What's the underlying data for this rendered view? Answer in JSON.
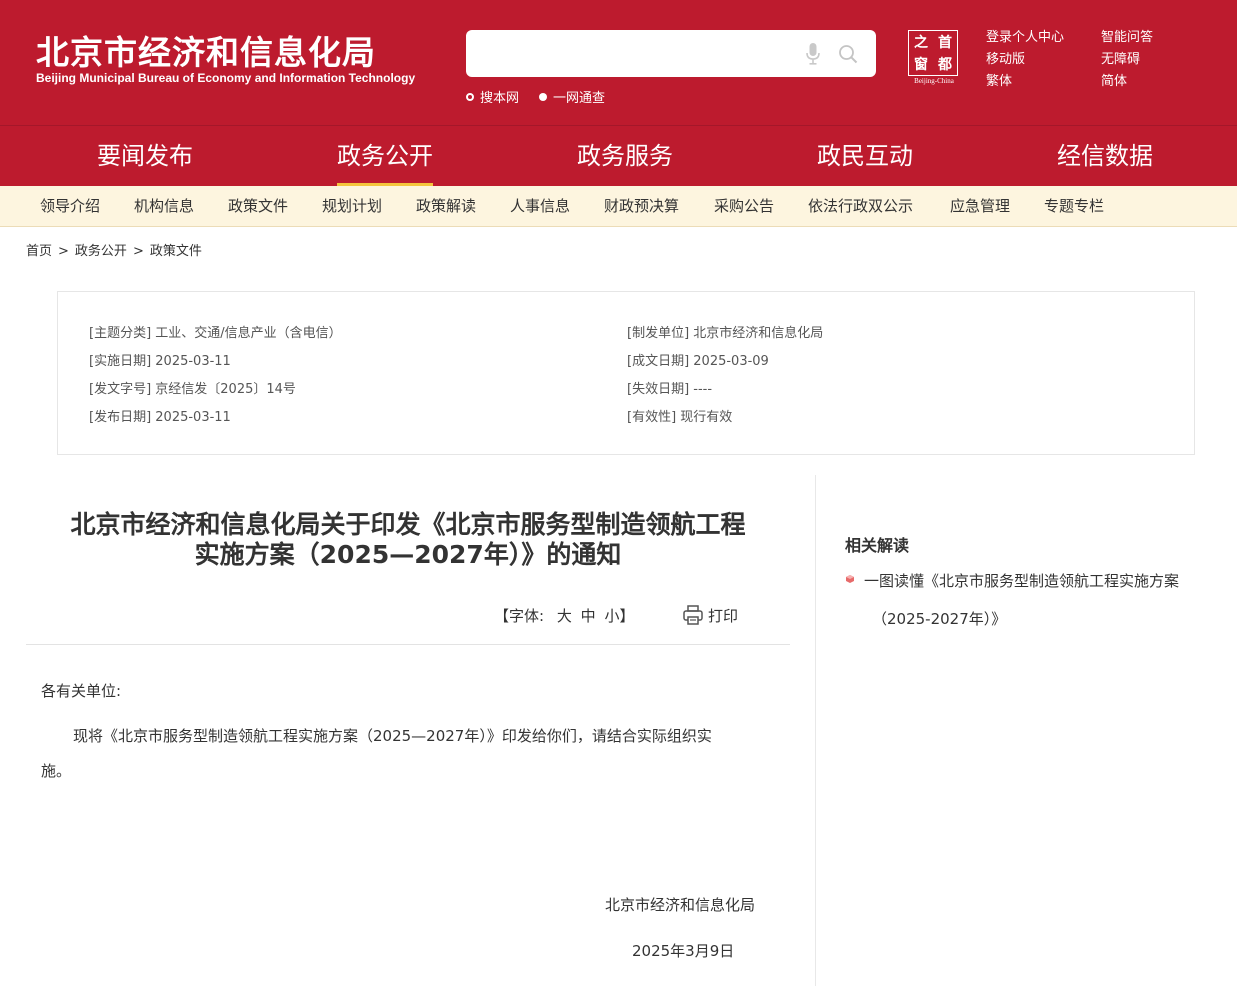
{
  "header": {
    "logo_cn": "北京市经济和信息化局",
    "logo_en": "Beijing Municipal Bureau of Economy and Information Technology",
    "search": {
      "placeholder": "",
      "scope_site": "搜本网",
      "scope_all": "一网通查"
    },
    "seal": {
      "chars": [
        "之",
        "首",
        "窗",
        "都"
      ],
      "en": "Beijing-China"
    },
    "links": {
      "login": "登录个人中心",
      "qa": "智能问答",
      "mobile": "移动版",
      "accessible": "无障碍",
      "traditional": "繁体",
      "simplified": "简体"
    },
    "colors": {
      "brand": "#bd1b2e",
      "accent": "#f4c53d",
      "subnav_bg": "#fdf5df"
    }
  },
  "main_nav": [
    "要闻发布",
    "政务公开",
    "政务服务",
    "政民互动",
    "经信数据"
  ],
  "sub_nav": [
    "领导介绍",
    "机构信息",
    "政策文件",
    "规划计划",
    "政策解读",
    "人事信息",
    "财政预决算",
    "采购公告",
    "依法行政双公示",
    "应急管理",
    "专题专栏"
  ],
  "breadcrumb": {
    "home": "首页",
    "level1": "政务公开",
    "level2": "政策文件",
    "sep": ">"
  },
  "meta": {
    "topic": "[主题分类] 工业、交通/信息产业（含电信）",
    "impl_date": "[实施日期] 2025-03-11",
    "doc_no": "[发文字号] 京经信发〔2025〕14号",
    "pub_date": "[发布日期] 2025-03-11",
    "issuer": "[制发单位] 北京市经济和信息化局",
    "written_date": "[成文日期] 2025-03-09",
    "expire_date": "[失效日期] ----",
    "validity": "[有效性] 现行有效"
  },
  "article": {
    "title_line1": "北京市经济和信息化局关于印发《北京市服务型制造领航工程",
    "title_line2": "实施方案（2025—2027年）》的通知",
    "font_label": "【字体:",
    "font_large": "大",
    "font_medium": "中",
    "font_small": "小",
    "font_close": "】",
    "print_label": "打印",
    "salutation": "各有关单位:",
    "body_line1": "现将《北京市服务型制造领航工程实施方案（2025—2027年）》印发给你们，请结合实际组织实",
    "body_line2": "施。",
    "signature": "北京市经济和信息化局",
    "date": "2025年3月9日"
  },
  "sidebar": {
    "title": "相关解读",
    "link_line1": "一图读懂《北京市服务型制造领航工程实施方案",
    "link_line2": "（2025-2027年）》"
  },
  "icons": [
    "mic-icon",
    "search-icon",
    "print-icon",
    "bullet-icon"
  ]
}
